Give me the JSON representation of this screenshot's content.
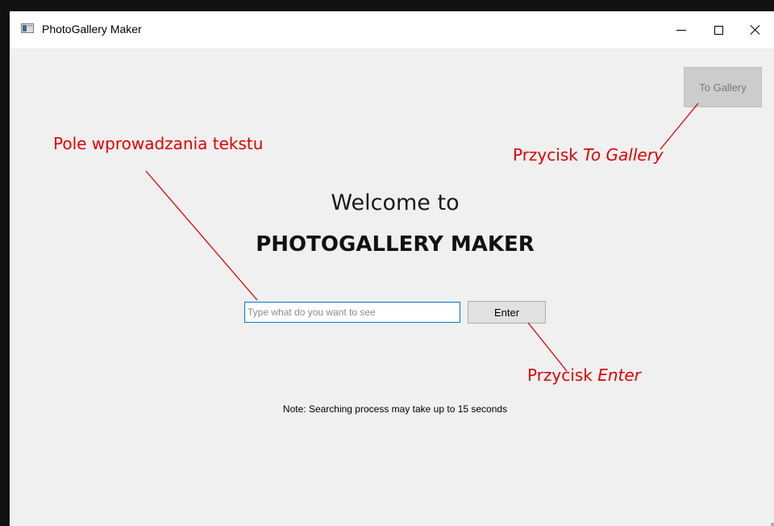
{
  "window": {
    "title": "PhotoGallery Maker",
    "icon": "app-window-icon"
  },
  "titlebar_controls": {
    "minimize_icon": "minimize-icon",
    "maximize_icon": "maximize-icon",
    "close_icon": "close-icon"
  },
  "toolbar": {
    "to_gallery_label": "To Gallery"
  },
  "main": {
    "welcome": "Welcome to",
    "app_name": "PHOTOGALLERY MAKER",
    "search_placeholder": "Type what do you want to see",
    "search_value": "",
    "enter_label": "Enter",
    "note": "Note: Searching process may take up to 15 seconds"
  },
  "annotations": {
    "input_label": "Pole wprowadzania tekstu",
    "gallery_prefix": "Przycisk ",
    "gallery_name": "To Gallery",
    "enter_prefix": "Przycisk ",
    "enter_name": "Enter"
  },
  "colors": {
    "annotation": "#e00000",
    "window_bg": "#f0f0f0",
    "input_focus_border": "#0078d7",
    "disabled_button_bg": "#cccccc"
  }
}
